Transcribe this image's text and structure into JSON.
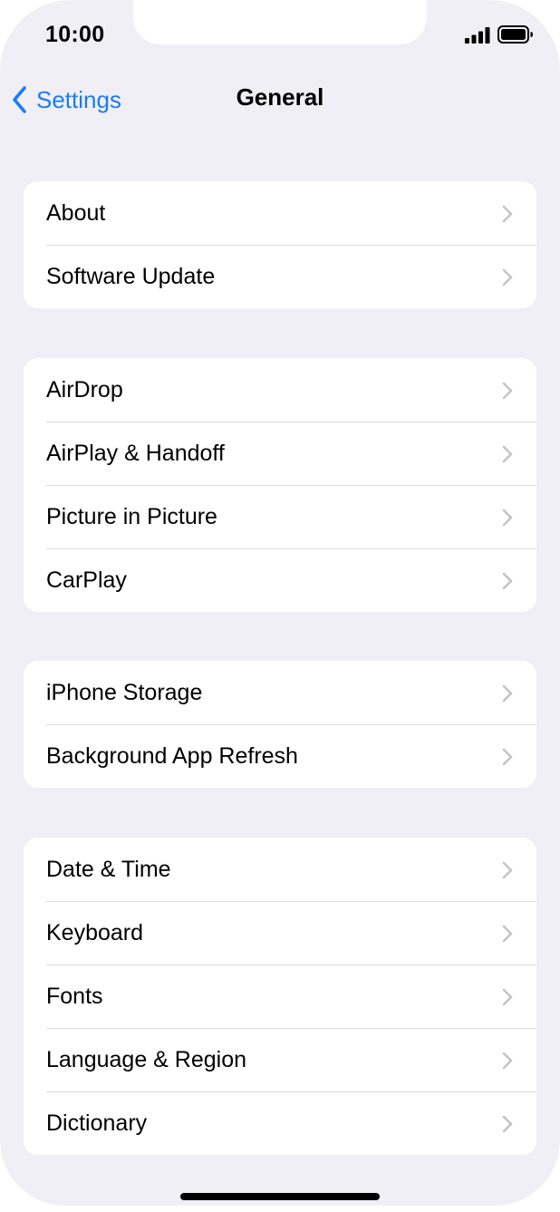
{
  "status_bar": {
    "time": "10:00",
    "signal_icon": "cellular-signal-icon",
    "battery_icon": "battery-icon"
  },
  "nav": {
    "back_label": "Settings",
    "back_icon": "chevron-left-icon",
    "title": "General"
  },
  "groups": [
    {
      "items": [
        {
          "label": "About"
        },
        {
          "label": "Software Update"
        }
      ]
    },
    {
      "items": [
        {
          "label": "AirDrop"
        },
        {
          "label": "AirPlay & Handoff"
        },
        {
          "label": "Picture in Picture"
        },
        {
          "label": "CarPlay"
        }
      ]
    },
    {
      "items": [
        {
          "label": "iPhone Storage"
        },
        {
          "label": "Background App Refresh"
        }
      ]
    },
    {
      "items": [
        {
          "label": "Date & Time"
        },
        {
          "label": "Keyboard"
        },
        {
          "label": "Fonts"
        },
        {
          "label": "Language & Region"
        },
        {
          "label": "Dictionary"
        }
      ]
    }
  ],
  "colors": {
    "background": "#f0eff5",
    "accent": "#1a7cf5",
    "chevron": "#c4c4c7",
    "separator": "#dcdce0"
  }
}
